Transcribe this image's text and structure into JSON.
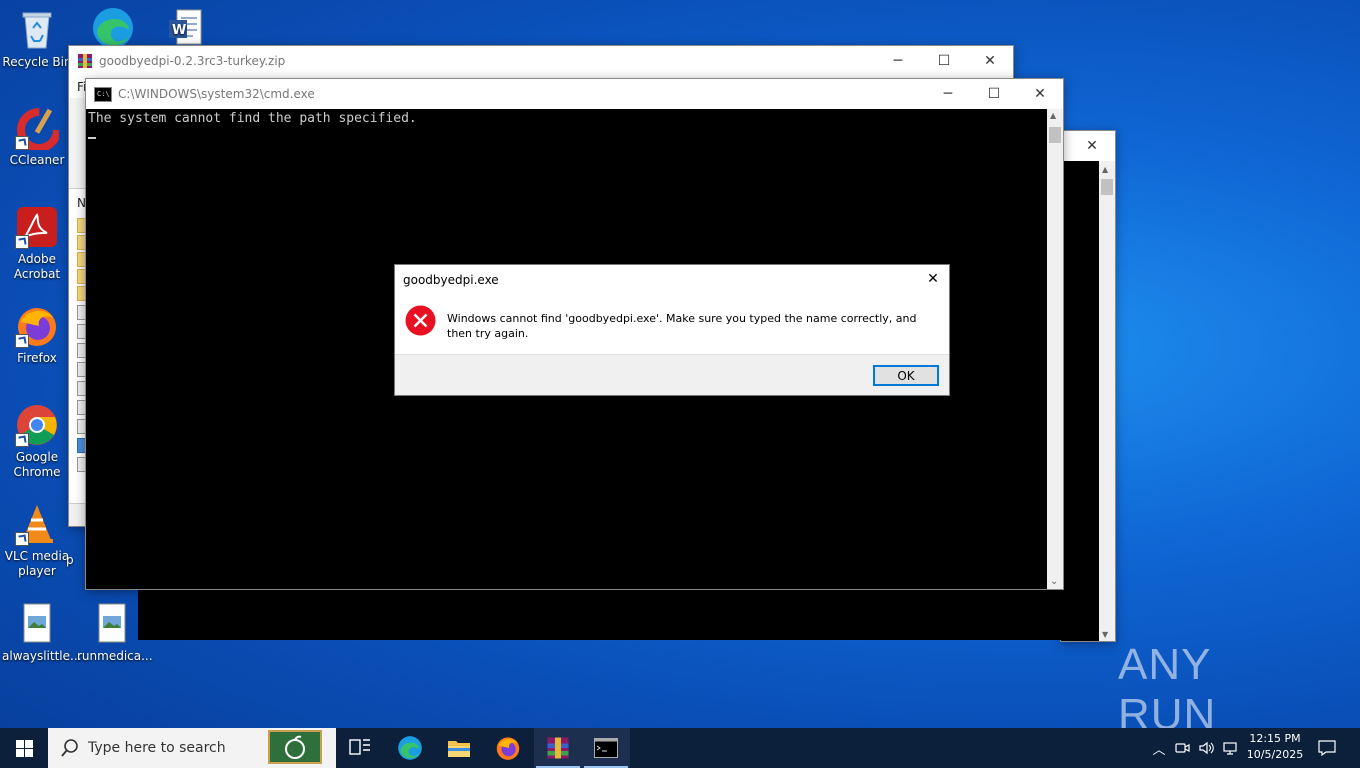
{
  "desktop": {
    "icons": [
      {
        "label": "Recycle Bin"
      },
      {
        "label": "CCleaner"
      },
      {
        "label": "Adobe Acrobat"
      },
      {
        "label": "Firefox"
      },
      {
        "label": "Google Chrome"
      },
      {
        "label": "VLC media player"
      },
      {
        "label": "alwayslittle..."
      },
      {
        "label": "runmedica..."
      },
      {
        "label": "p"
      }
    ],
    "watermark": "ANY RUN"
  },
  "winrar_window": {
    "title": "goodbyedpi-0.2.3rc3-turkey.zip",
    "menu_partial": "Fi",
    "column_partial": "N"
  },
  "cmd_window": {
    "title": "C:\\WINDOWS\\system32\\cmd.exe",
    "output_line": "The system cannot find the path specified."
  },
  "dialog": {
    "title": "goodbyedpi.exe",
    "message": "Windows cannot find 'goodbyedpi.exe'. Make sure you typed the name correctly, and then try again.",
    "ok_label": "OK"
  },
  "taskbar": {
    "search_placeholder": "Type here to search",
    "time": "12:15 PM",
    "date": "10/5/2025"
  },
  "colors": {
    "accent": "#0078d7",
    "error_red": "#e81123",
    "taskbar": "#0c1f3b"
  }
}
